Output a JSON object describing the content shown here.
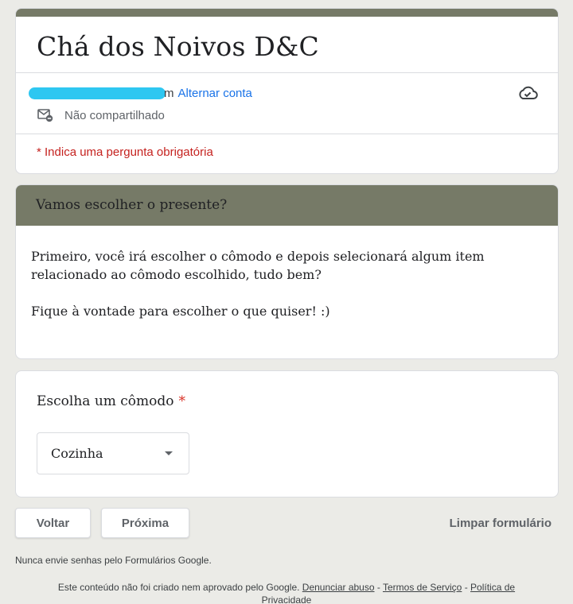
{
  "form": {
    "title": "Chá dos Noivos D&C",
    "account_tail": "m",
    "switch_account": "Alternar conta",
    "not_shared": "Não compartilhado",
    "required_note": "* Indica uma pergunta obrigatória",
    "redact_color": "#2ec7f1",
    "theme_color": "#767a67"
  },
  "section": {
    "title": "Vamos escolher o presente?",
    "description_1": "Primeiro, você irá escolher o cômodo e depois selecionará algum item relacionado ao cômodo escolhido, tudo bem?",
    "description_2": "Fique à vontade para escolher o que quiser! :)"
  },
  "question": {
    "title": "Escolha um cômodo",
    "required_mark": "*",
    "selected_value": "Cozinha"
  },
  "nav": {
    "back": "Voltar",
    "next": "Próxima",
    "clear": "Limpar formulário"
  },
  "footer": {
    "warning": "Nunca envie senhas pelo Formulários Google.",
    "disclaimer": "Este conteúdo não foi criado nem aprovado pelo Google.",
    "report_abuse": "Denunciar abuso",
    "sep1": " - ",
    "terms": "Termos de Serviço",
    "sep2": " - ",
    "privacy": "Política de Privacidade"
  },
  "icons": {
    "cloud": "cloud-check-icon",
    "mail": "mail-not-shared-icon",
    "dropdown": "dropdown-arrow-icon"
  }
}
